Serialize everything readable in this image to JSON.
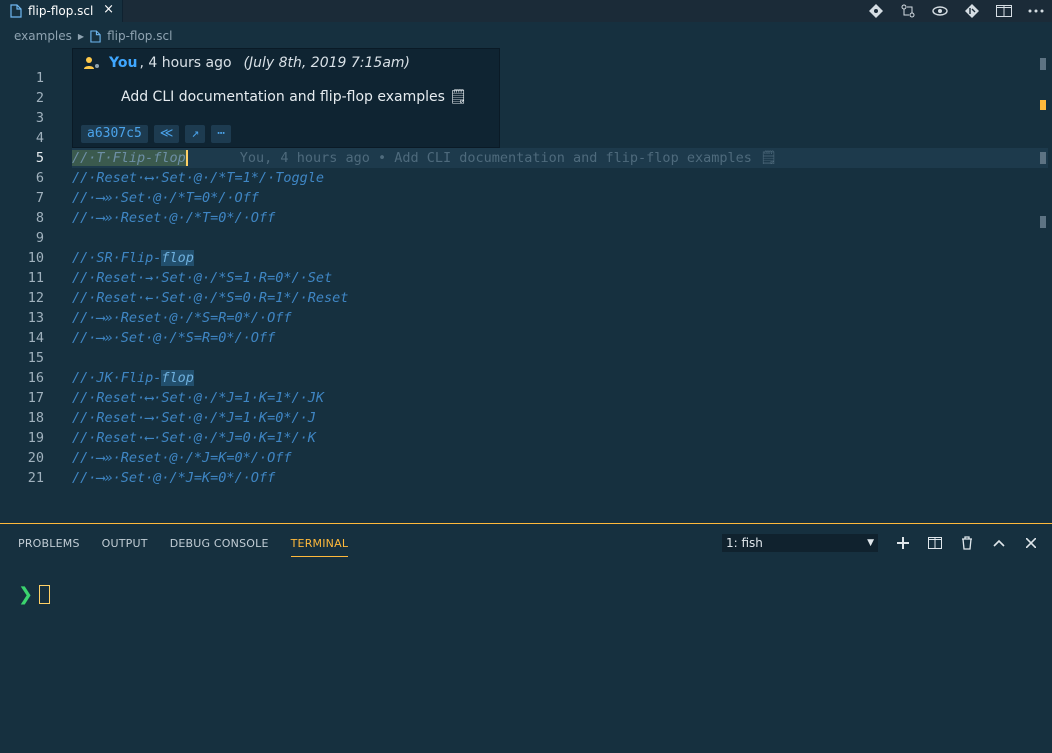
{
  "tab": {
    "title": "flip-flop.scl",
    "close": "×"
  },
  "actions": [
    "commit-icon",
    "compare-icon",
    "blame-icon",
    "git-icon",
    "split-icon",
    "more-icon"
  ],
  "breadcrumb": {
    "folder": "examples",
    "file": "flip-flop.scl"
  },
  "hover": {
    "author": "You",
    "ago": ", 4 hours ago",
    "date": "(July 8th, 2019 7:15am)",
    "message": "Add CLI documentation and flip-flop examples 🗒",
    "sha": "a6307c5",
    "prev_button": "≪",
    "open_button": "↗",
    "more_button": "⋯"
  },
  "lines": [
    {
      "n": "1",
      "t": ""
    },
    {
      "n": "2",
      "t": ""
    },
    {
      "n": "3",
      "t": ""
    },
    {
      "n": "4",
      "t": ""
    },
    {
      "n": "5",
      "t": "//·T·Flip-flop"
    },
    {
      "n": "6",
      "t": "//·Reset·⟷·Set·@·/*T=1*/·Toggle"
    },
    {
      "n": "7",
      "t": "//·⟶»·Set·@·/*T=0*/·Off"
    },
    {
      "n": "8",
      "t": "//·⟶»·Reset·@·/*T=0*/·Off"
    },
    {
      "n": "9",
      "t": ""
    },
    {
      "n": "10",
      "t": "//·SR·Flip-flop"
    },
    {
      "n": "11",
      "t": "//·Reset·→·Set·@·/*S=1·R=0*/·Set"
    },
    {
      "n": "12",
      "t": "//·Reset·←·Set·@·/*S=0·R=1*/·Reset"
    },
    {
      "n": "13",
      "t": "//·⟶»·Reset·@·/*S=R=0*/·Off"
    },
    {
      "n": "14",
      "t": "//·⟶»·Set·@·/*S=R=0*/·Off"
    },
    {
      "n": "15",
      "t": ""
    },
    {
      "n": "16",
      "t": "//·JK·Flip-flop"
    },
    {
      "n": "17",
      "t": "//·Reset·⟷·Set·@·/*J=1·K=1*/·JK"
    },
    {
      "n": "18",
      "t": "//·Reset·⟶·Set·@·/*J=1·K=0*/·J"
    },
    {
      "n": "19",
      "t": "//·Reset·⟵·Set·@·/*J=0·K=1*/·K"
    },
    {
      "n": "20",
      "t": "//·⟶»·Reset·@·/*J=K=0*/·Off"
    },
    {
      "n": "21",
      "t": "//·⟶»·Set·@·/*J=K=0*/·Off"
    }
  ],
  "current_line": {
    "sel1": "//·T·",
    "sel2": "Flip-",
    "word": "flop",
    "blame": "You, 4 hours ago • Add CLI documentation and flip-flop examples 🗒"
  },
  "panel": {
    "tabs": [
      "PROBLEMS",
      "OUTPUT",
      "DEBUG CONSOLE",
      "TERMINAL"
    ],
    "active_tab": "TERMINAL",
    "terminal_select": "1: fish",
    "actions": [
      "+",
      "split",
      "trash",
      "^",
      "×"
    ],
    "prompt": "❯"
  },
  "colors": {
    "accent": "#ffb93b",
    "comment": "#3f86c4",
    "author": "#3fa7ff",
    "prompt": "#3bd36e"
  }
}
